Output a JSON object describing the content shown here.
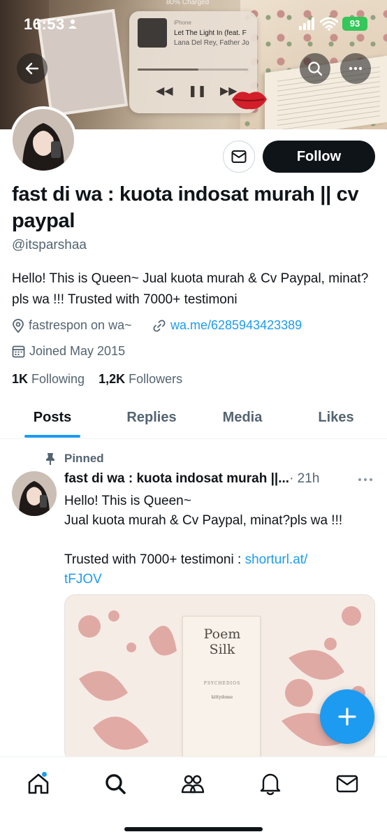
{
  "status_bar": {
    "time": "16:53",
    "charging_label": "80% Charged",
    "battery": "93"
  },
  "banner": {
    "now_playing": {
      "source": "iPhone",
      "song": "Let The Light In (feat. F",
      "artist": "Lana Del Rey, Father Jo",
      "progress": 0.55
    }
  },
  "profile": {
    "follow_label": "Follow",
    "display_name": "fast di wa : kuota indosat murah || cv paypal",
    "handle": "@itsparshaa",
    "bio": "Hello! This is Queen~ Jual kuota murah & Cv Paypal, minat?pls wa !!! Trusted with 7000+ testimoni",
    "location": "fastrespon on wa~",
    "link": "wa.me/6285943423389",
    "joined": "Joined May 2015",
    "following_count": "1K",
    "following_label": "Following",
    "followers_count": "1,2K",
    "followers_label": "Followers"
  },
  "tabs": [
    {
      "label": "Posts",
      "active": true
    },
    {
      "label": "Replies",
      "active": false
    },
    {
      "label": "Media",
      "active": false
    },
    {
      "label": "Likes",
      "active": false
    }
  ],
  "pinned_tweet": {
    "pinned_label": "Pinned",
    "author_name": "fast di wa : kuota indosat murah ||...",
    "time": "· 21h",
    "line1": "Hello! This is Queen~",
    "line2": "Jual kuota murah & Cv Paypal, minat?pls wa !!!",
    "line3_prefix": "Trusted with 7000+ testimoni : ",
    "line3_link": "shorturl.at/",
    "line4_link": "tFJOV",
    "media": {
      "title_line1": "Poem",
      "title_line2": "Silk",
      "subtitle": "PSYCHEDIOS",
      "subtitle2": "kittydome"
    }
  },
  "bottom_nav": {
    "items": [
      "home-icon",
      "search-icon",
      "communities-icon",
      "notifications-icon",
      "messages-icon"
    ],
    "home_has_dot": true
  },
  "colors": {
    "accent": "#1d9bf0",
    "text": "#0f1419",
    "secondary": "#536471"
  }
}
